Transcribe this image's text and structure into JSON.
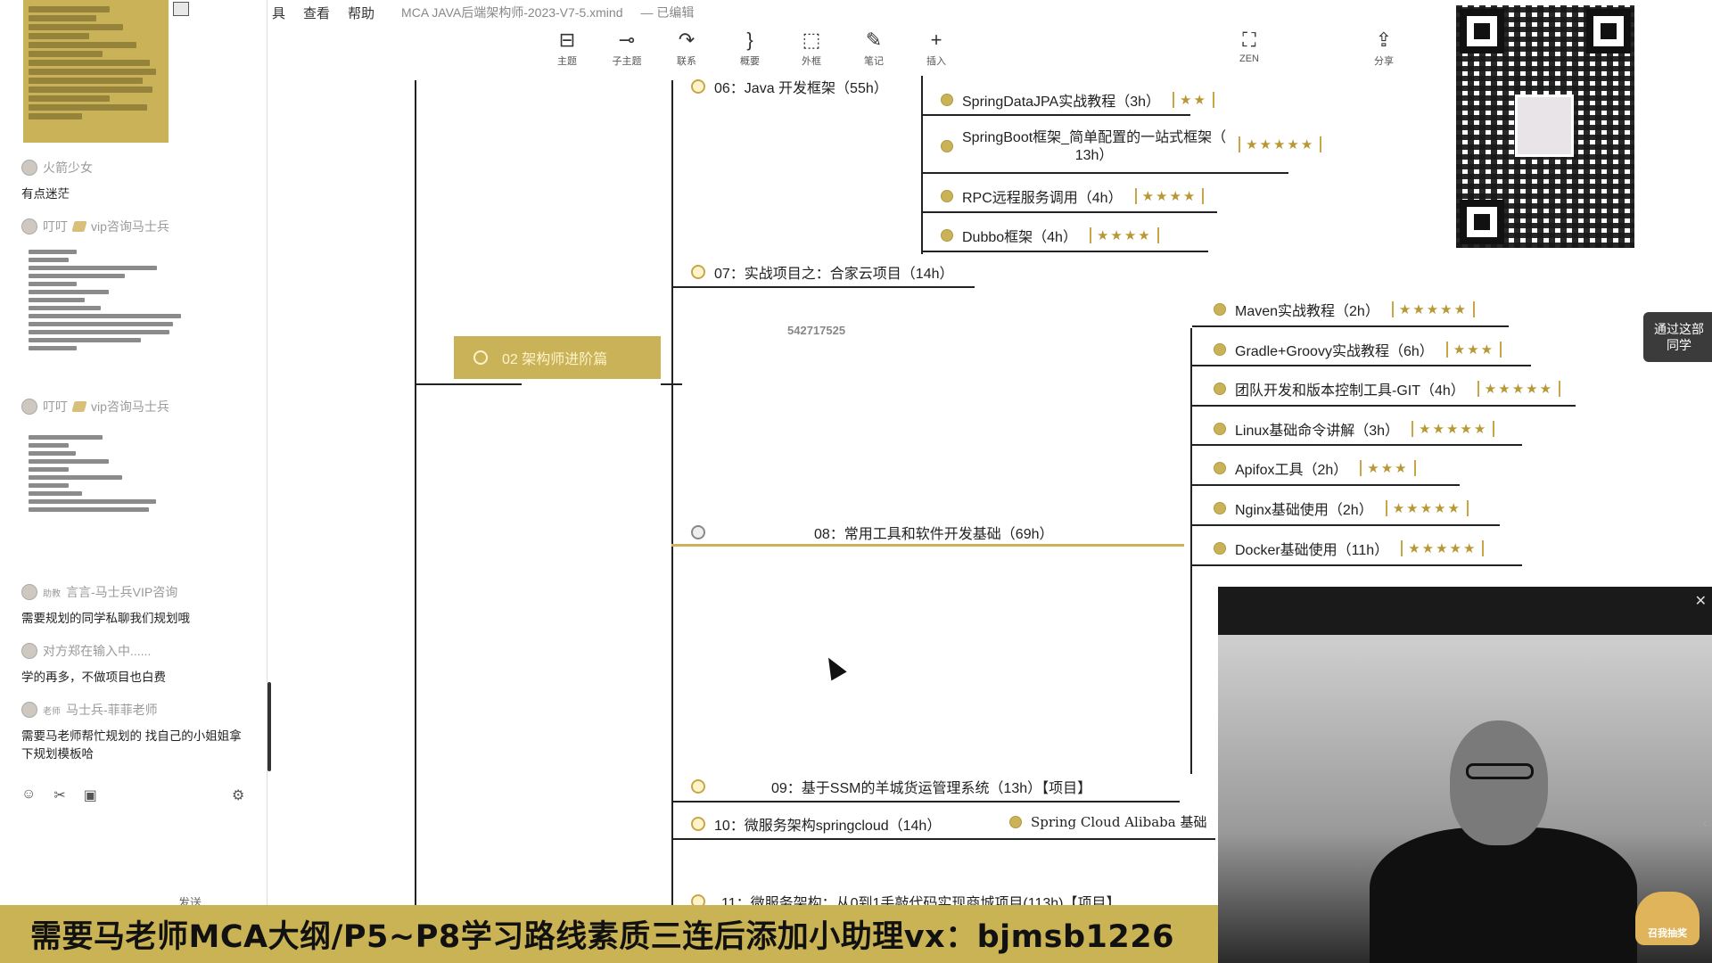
{
  "menubar": {
    "items": [
      "具",
      "查看",
      "帮助"
    ],
    "file_title": "MCA JAVA后端架构师-2023-V7-5.xmind",
    "status": "— 已编辑"
  },
  "toolbar": {
    "buttons": [
      {
        "label": "主题",
        "icon": "topic-icon",
        "glyph": "⊟"
      },
      {
        "label": "子主题",
        "icon": "subtopic-icon",
        "glyph": "⊸"
      },
      {
        "label": "联系",
        "icon": "relationship-icon",
        "glyph": "↷"
      },
      {
        "label": "概要",
        "icon": "summary-icon",
        "glyph": "}"
      },
      {
        "label": "外框",
        "icon": "boundary-icon",
        "glyph": "⬚"
      },
      {
        "label": "笔记",
        "icon": "note-icon",
        "glyph": "✎"
      },
      {
        "label": "插入",
        "icon": "insert-icon",
        "glyph": "+"
      },
      {
        "label": "ZEN",
        "icon": "zen-mode-icon",
        "glyph": "⛶"
      },
      {
        "label": "分享",
        "icon": "share-icon",
        "glyph": "⇪"
      }
    ]
  },
  "chat": {
    "messages": [
      {
        "user": "火箭少女",
        "role": "",
        "text": "有点迷茫"
      },
      {
        "user": "叮叮",
        "role": "",
        "suffix": "vip咨询马士兵",
        "text": ""
      },
      {
        "user": "叮叮",
        "role": "",
        "suffix": "vip咨询马士兵",
        "text": ""
      },
      {
        "user": "言言-马士兵VIP咨询",
        "role": "助教",
        "text": "需要规划的同学私聊我们规划哦"
      },
      {
        "user": "对方郑在输入中......",
        "role": "",
        "text": "学的再多，不做项目也白费"
      },
      {
        "user": "马士兵-菲菲老师",
        "role": "老师",
        "text": "需要马老师帮忙规划的 找自己的小姐姐拿下规划模板哈"
      }
    ],
    "send_label": "发送",
    "tools": [
      "emoji-icon",
      "scissors-icon",
      "image-icon",
      "settings-icon"
    ]
  },
  "map": {
    "branch_title": "02 架构师进阶篇",
    "watermark": "542717525",
    "topics": [
      {
        "label": "06：Java 开发框架（55h）"
      },
      {
        "label": "07：实战项目之：合家云项目（14h）"
      },
      {
        "label": "08：常用工具和软件开发基础（69h）"
      },
      {
        "label": "09：基于SSM的羊城货运管理系统（13h）【项目】"
      },
      {
        "label": "10：微服务架构springcloud（14h）"
      },
      {
        "label": "11：微服务架构：从0到1手敲代码实现商城项目(113h)【项目】"
      }
    ],
    "sub06": [
      {
        "label": "SpringDataJPA实战教程（3h）",
        "stars": 2
      },
      {
        "label": "SpringBoot框架_简单配置的一站式框架（",
        "label2": "13h）",
        "stars": 5
      },
      {
        "label": "RPC远程服务调用（4h）",
        "stars": 4
      },
      {
        "label": "Dubbo框架（4h）",
        "stars": 4
      }
    ],
    "sub08": [
      {
        "label": "Maven实战教程（2h）",
        "stars": 5
      },
      {
        "label": "Gradle+Groovy实战教程（6h）",
        "stars": 3
      },
      {
        "label": "团队开发和版本控制工具-GIT（4h）",
        "stars": 5
      },
      {
        "label": "Linux基础命令讲解（3h）",
        "stars": 5
      },
      {
        "label": "Apifox工具（2h）",
        "stars": 3
      },
      {
        "label": "Nginx基础使用（2h）",
        "stars": 5
      },
      {
        "label": "Docker基础使用（11h）",
        "stars": 5
      }
    ],
    "sub10": {
      "label": "Spring Cloud Alibaba 基础"
    }
  },
  "side_tag": {
    "line1": "通过这部",
    "line2": "同学"
  },
  "video": {
    "badge": "召我抽奖"
  },
  "banner": {
    "text": "需要马老师MCA大纲/P5~P8学习路线素质三连后添加小助理vx：bjmsb1226"
  },
  "colors": {
    "accent": "#c9b258",
    "banner": "#c9b354",
    "line": "#222222"
  }
}
